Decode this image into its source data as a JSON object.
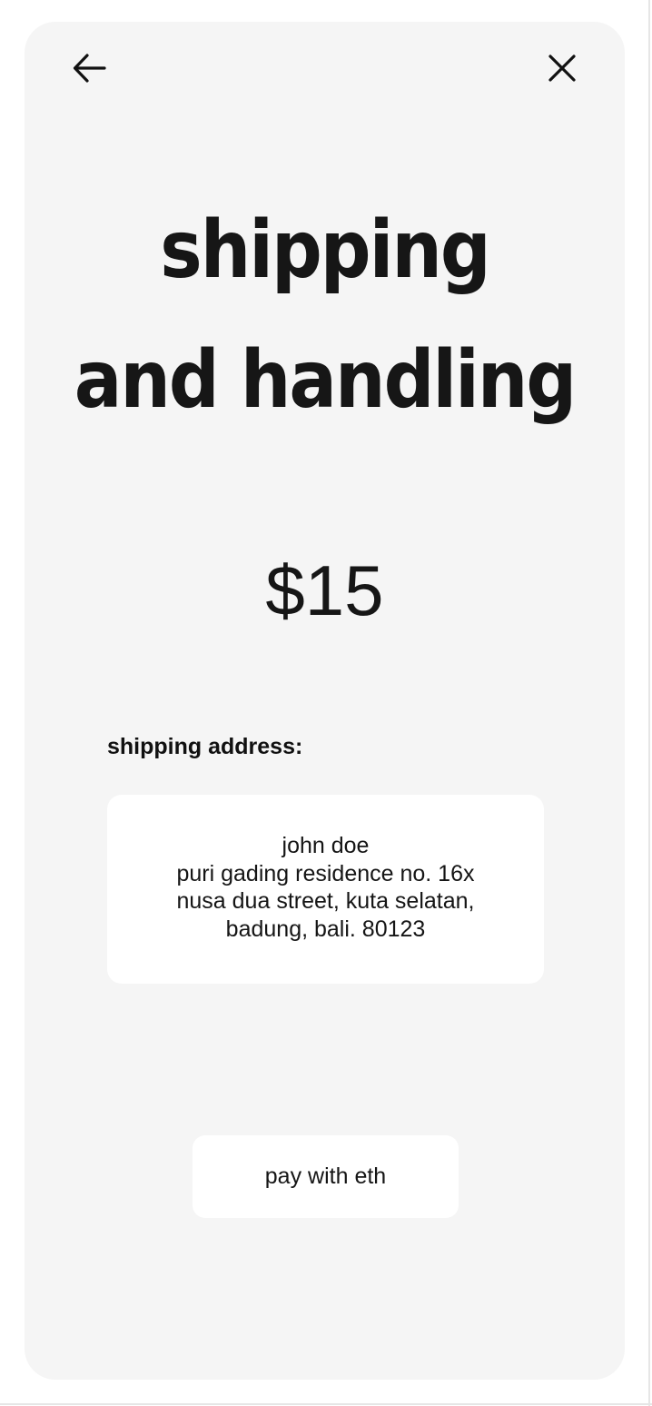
{
  "header": {
    "back_icon": "arrow-left-icon",
    "close_icon": "close-icon"
  },
  "title": {
    "line1": "shipping",
    "line2": "and handling"
  },
  "price": "$15",
  "address": {
    "label": "shipping address:",
    "lines": [
      "john doe",
      "puri gading residence no. 16x",
      "nusa dua street, kuta selatan,",
      "badung, bali. 80123"
    ]
  },
  "pay_button": {
    "label": "pay with eth"
  },
  "colors": {
    "card_background": "#f5f5f5",
    "page_background": "#ffffff",
    "text": "#161616",
    "surface": "#ffffff"
  }
}
